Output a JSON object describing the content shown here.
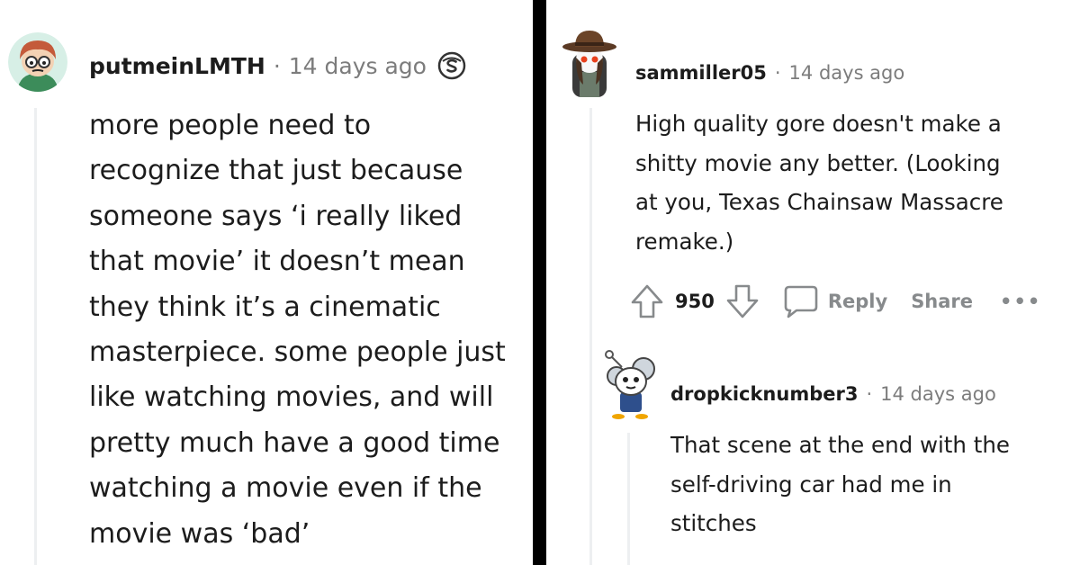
{
  "left_comment": {
    "username": "putmeinLMTH",
    "separator": "·",
    "time": "14 days ago",
    "badge_icon": "s-award-icon",
    "lines": [
      "more people need to",
      "recognize that just because",
      "someone says ‘i really liked",
      "that movie’ it doesn’t mean",
      "they think it’s a cinematic",
      "masterpiece. some people just",
      "like watching movies, and will",
      "pretty much have a good time",
      "watching a movie even if the",
      "movie was ‘bad’"
    ]
  },
  "right_comment": {
    "username": "sammiller05",
    "separator": "·",
    "time": "14 days ago",
    "lines": [
      "High quality gore doesn't make a",
      "shitty movie any better. (Looking",
      "at you, Texas Chainsaw Massacre",
      "remake.)"
    ],
    "actions": {
      "score": "950",
      "reply_label": "Reply",
      "share_label": "Share",
      "more_label": "•••"
    }
  },
  "child_comment": {
    "username": "dropkicknumber3",
    "separator": "·",
    "time": "14 days ago",
    "lines": [
      "That scene at the end with the",
      "self-driving car had me in",
      "stitches"
    ]
  },
  "colors": {
    "text": "#1c1c1c",
    "meta": "#7c7c7c",
    "action": "#878a8c",
    "thread_line": "#edeff1",
    "divider": "#000000"
  }
}
